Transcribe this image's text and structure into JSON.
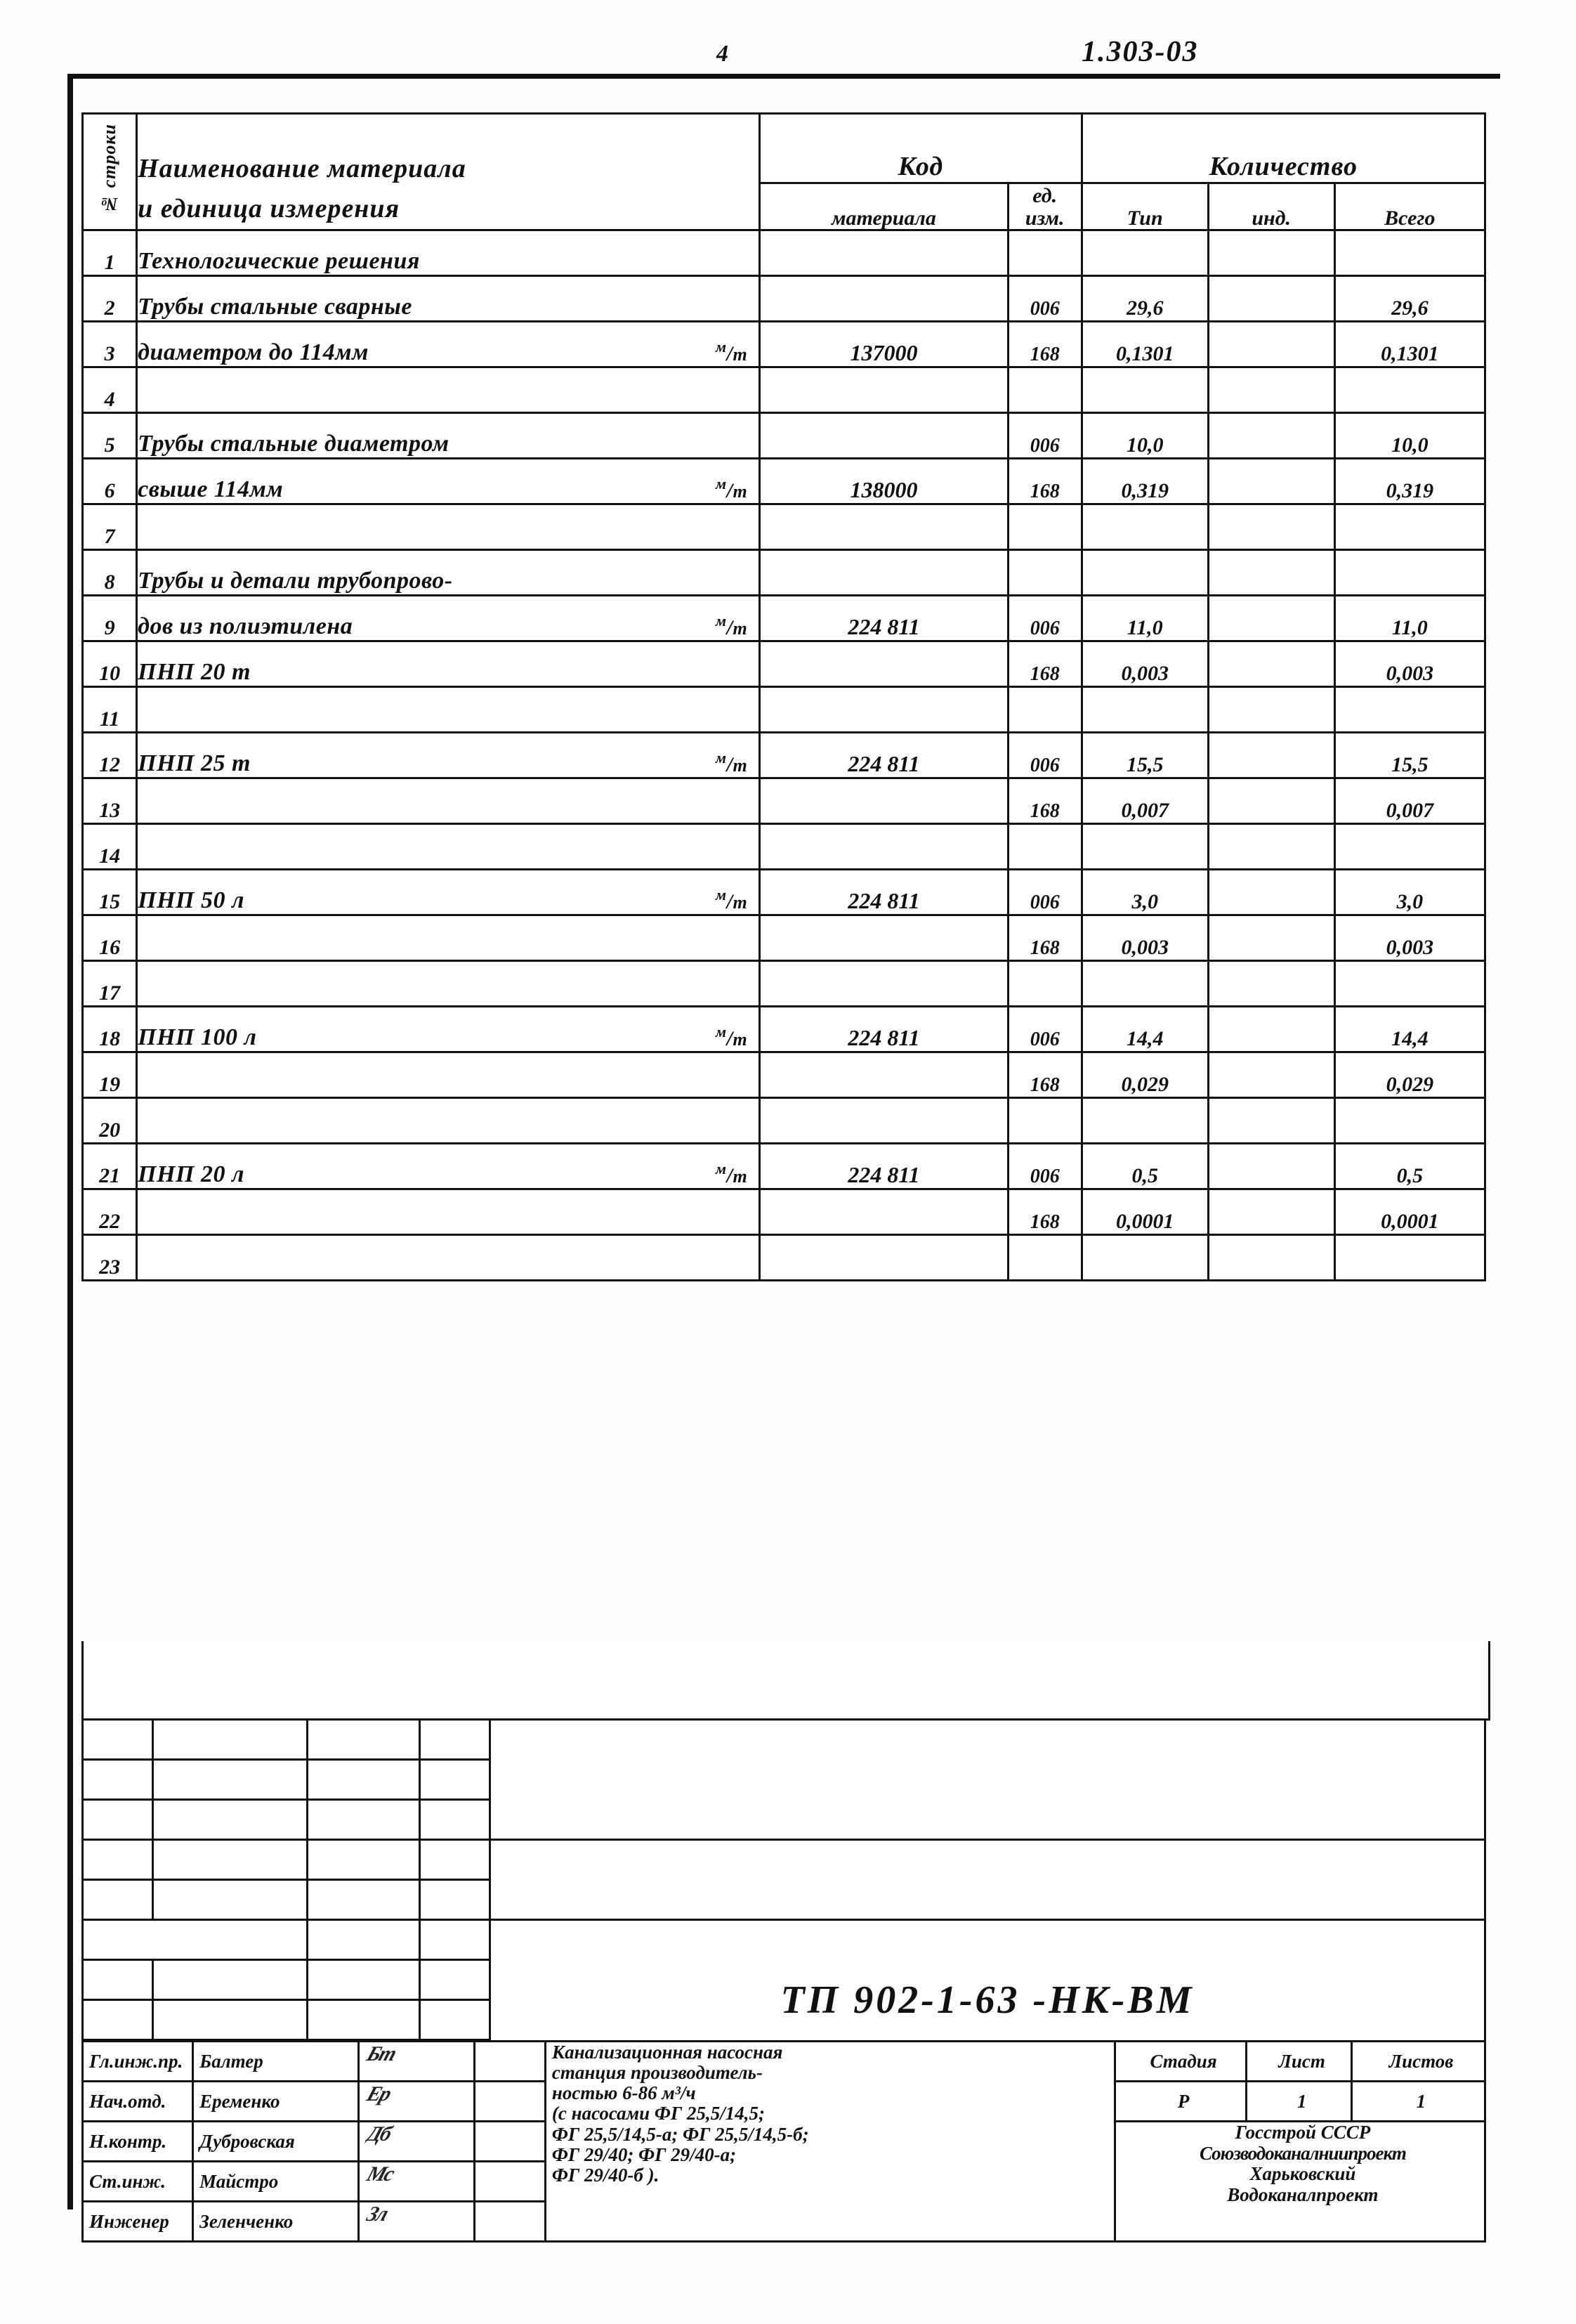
{
  "header": {
    "doc_number": "1.303-03",
    "sheet_mark": "4"
  },
  "table": {
    "columns": {
      "row_no": "№ строки",
      "name": "Наименование материала\nи единица измерения",
      "code_group": "Код",
      "code_material": "материала",
      "code_unit": "ед.\nизм.",
      "qty_group": "Количество",
      "qty_type": "Тип",
      "qty_ind": "инд.",
      "qty_total": "Всего"
    },
    "col_code_material": "материала",
    "col_code_unit_1": "ед.",
    "col_code_unit_2": "изм.",
    "rows": [
      {
        "no": "1",
        "name": "Технологические   решения",
        "unit": "",
        "mat": "",
        "u": "",
        "type": "",
        "ind": "",
        "total": ""
      },
      {
        "no": "2",
        "name": "Трубы стальные   сварные",
        "unit": "",
        "mat": "",
        "u": "006",
        "type": "29,6",
        "ind": "",
        "total": "29,6"
      },
      {
        "no": "3",
        "name": "диаметром до 114мм",
        "unit": "м/т",
        "mat": "137000",
        "u": "168",
        "type": "0,1301",
        "ind": "",
        "total": "0,1301"
      },
      {
        "no": "4",
        "name": "",
        "unit": "",
        "mat": "",
        "u": "",
        "type": "",
        "ind": "",
        "total": ""
      },
      {
        "no": "5",
        "name": "Трубы стальные   диаметром",
        "unit": "",
        "mat": "",
        "u": "006",
        "type": "10,0",
        "ind": "",
        "total": "10,0"
      },
      {
        "no": "6",
        "name": "свыше   114мм",
        "unit": "м/т",
        "mat": "138000",
        "u": "168",
        "type": "0,319",
        "ind": "",
        "total": "0,319"
      },
      {
        "no": "7",
        "name": "",
        "unit": "",
        "mat": "",
        "u": "",
        "type": "",
        "ind": "",
        "total": ""
      },
      {
        "no": "8",
        "name": "Трубы  и детали  трубопрово-",
        "unit": "",
        "mat": "",
        "u": "",
        "type": "",
        "ind": "",
        "total": ""
      },
      {
        "no": "9",
        "name": "дов из полиэтилена",
        "unit": "м/т",
        "mat": "224 811",
        "u": "006",
        "type": "11,0",
        "ind": "",
        "total": "11,0"
      },
      {
        "no": "10",
        "name": "ПНП   20 т",
        "unit": "",
        "mat": "",
        "u": "168",
        "type": "0,003",
        "ind": "",
        "total": "0,003"
      },
      {
        "no": "11",
        "name": "",
        "unit": "",
        "mat": "",
        "u": "",
        "type": "",
        "ind": "",
        "total": ""
      },
      {
        "no": "12",
        "name": "ПНП   25 т",
        "unit": "м/т",
        "mat": "224 811",
        "u": "006",
        "type": "15,5",
        "ind": "",
        "total": "15,5"
      },
      {
        "no": "13",
        "name": "",
        "unit": "",
        "mat": "",
        "u": "168",
        "type": "0,007",
        "ind": "",
        "total": "0,007"
      },
      {
        "no": "14",
        "name": "",
        "unit": "",
        "mat": "",
        "u": "",
        "type": "",
        "ind": "",
        "total": ""
      },
      {
        "no": "15",
        "name": "ПНП  50 л",
        "unit": "м/т",
        "mat": "224 811",
        "u": "006",
        "type": "3,0",
        "ind": "",
        "total": "3,0"
      },
      {
        "no": "16",
        "name": "",
        "unit": "",
        "mat": "",
        "u": "168",
        "type": "0,003",
        "ind": "",
        "total": "0,003"
      },
      {
        "no": "17",
        "name": "",
        "unit": "",
        "mat": "",
        "u": "",
        "type": "",
        "ind": "",
        "total": ""
      },
      {
        "no": "18",
        "name": "ПНП    100 л",
        "unit": "м/т",
        "mat": "224 811",
        "u": "006",
        "type": "14,4",
        "ind": "",
        "total": "14,4"
      },
      {
        "no": "19",
        "name": "",
        "unit": "",
        "mat": "",
        "u": "168",
        "type": "0,029",
        "ind": "",
        "total": "0,029"
      },
      {
        "no": "20",
        "name": "",
        "unit": "",
        "mat": "",
        "u": "",
        "type": "",
        "ind": "",
        "total": ""
      },
      {
        "no": "21",
        "name": "ПНП    20 л",
        "unit": "м/т",
        "mat": "224 811",
        "u": "006",
        "type": "0,5",
        "ind": "",
        "total": "0,5"
      },
      {
        "no": "22",
        "name": "",
        "unit": "",
        "mat": "",
        "u": "168",
        "type": "0,0001",
        "ind": "",
        "total": "0,0001"
      },
      {
        "no": "23",
        "name": "",
        "unit": "",
        "mat": "",
        "u": "",
        "type": "",
        "ind": "",
        "total": ""
      }
    ]
  },
  "title_block": {
    "main_code": "ТП 902-1-63 -НК-ВМ",
    "signatures": [
      {
        "role": "Гл.инж.пр.",
        "name": "Балтер",
        "sign": "Бт",
        "date": ""
      },
      {
        "role": "Нач.отд.",
        "name": "Еременко",
        "sign": "Ер",
        "date": ""
      },
      {
        "role": "Н.контр.",
        "name": "Дубровская",
        "sign": "Дб",
        "date": ""
      },
      {
        "role": "Ст.инж.",
        "name": "Майстро",
        "sign": "Мс",
        "date": ""
      },
      {
        "role": "Инженер",
        "name": "Зеленченко",
        "sign": "Зл",
        "date": ""
      }
    ],
    "description": [
      "Канализационная насосная",
      "станция производитель-",
      "ностью 6-86 м³/ч",
      "(с насосами ФГ 25,5/14,5;",
      "ФГ 25,5/14,5-а; ФГ 25,5/14,5-б;",
      "ФГ 29/40; ФГ 29/40-а;",
      "ФГ 29/40-б )."
    ],
    "stage_label": "Стадия",
    "sheet_label": "Лист",
    "sheets_label": "Листов",
    "stage_value": "Р",
    "sheet_value": "1",
    "sheets_value": "1",
    "organization": [
      "Госстрой  СССР",
      "Союзводоканалниипроект",
      "Харьковский",
      "Водоканалпроект"
    ]
  }
}
